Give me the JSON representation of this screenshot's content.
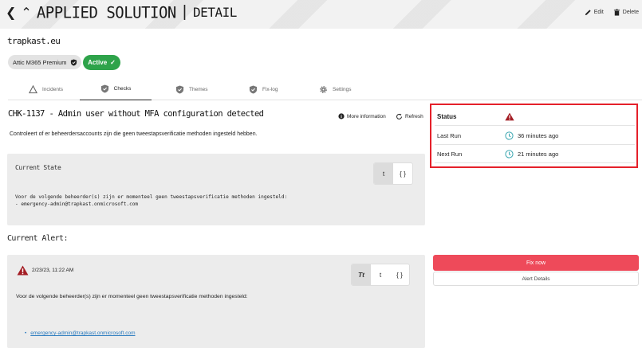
{
  "header": {
    "title": "APPLIED SOLUTION",
    "subtitle": "DETAIL",
    "edit_label": "Edit",
    "delete_label": "Delete"
  },
  "org": {
    "name": "trapkast.eu",
    "plan_badge": "Attic M365 Premium",
    "status_badge": "Active"
  },
  "tabs": [
    {
      "label": "Incidents",
      "icon": "warning-triangle-icon",
      "active": false
    },
    {
      "label": "Checks",
      "icon": "shield-check-icon",
      "active": true
    },
    {
      "label": "Themes",
      "icon": "shield-check-icon",
      "active": false
    },
    {
      "label": "Fix-log",
      "icon": "shield-check-icon",
      "active": false
    },
    {
      "label": "Settings",
      "icon": "gear-icon",
      "active": false
    }
  ],
  "check": {
    "title": "CHK-1137 - Admin user without MFA configuration detected",
    "more_info": "More information",
    "refresh": "Refresh",
    "description": "Controleert of er beheerdersaccounts zijn die geen tweestapsverificatie methoden ingesteld hebben."
  },
  "current_state": {
    "label": "Current State",
    "toggle": [
      "t",
      "{ }"
    ],
    "text_line1": "Voor de volgende beheerder(s) zijn er momenteel geen tweestapsverificatie methoden ingesteld:",
    "text_line2": "- emergency-admin@trapkast.onmicrosoft.com"
  },
  "current_alert": {
    "heading": "Current Alert:",
    "date": "2/23/23, 11:22 AM",
    "toggle": [
      "Tt",
      "t",
      "{ }"
    ],
    "text": "Voor de volgende beheerder(s) zijn er momenteel geen tweestapsverificatie methoden ingesteld:",
    "link": "emergency-admin@trapkast.onmicrosoft.com"
  },
  "status": {
    "heading": "Status",
    "last_run_label": "Last Run",
    "last_run_value": "36 minutes ago",
    "next_run_label": "Next Run",
    "next_run_value": "21 minutes ago"
  },
  "actions": {
    "fix_now": "Fix now",
    "alert_details": "Alert Details"
  },
  "colors": {
    "active_green": "#2ea34a",
    "alert_red": "#e5202a",
    "fix_button": "#ee4a5a",
    "link_blue": "#2a7bbf"
  }
}
